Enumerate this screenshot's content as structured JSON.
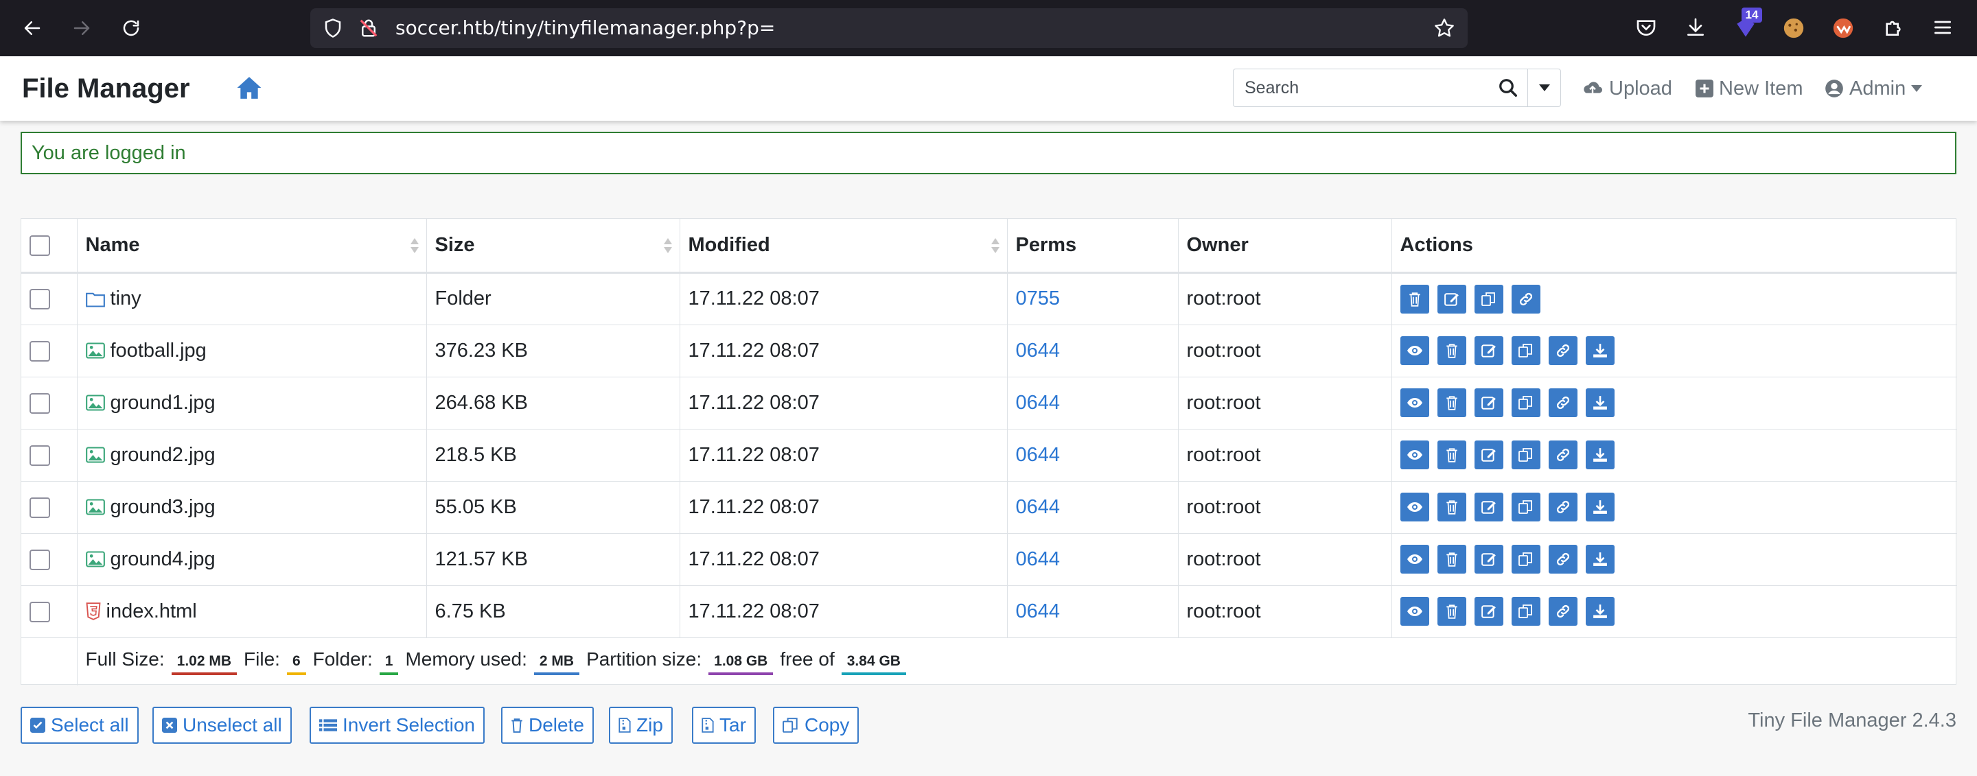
{
  "browser": {
    "url": "soccer.htb/tiny/tinyfilemanager.php?p=",
    "extension_badge": "14"
  },
  "header": {
    "title": "File Manager",
    "search_placeholder": "Search",
    "upload_label": "Upload",
    "new_item_label": "New Item",
    "user_label": "Admin"
  },
  "alert": {
    "message": "You are logged in"
  },
  "table": {
    "columns": {
      "name": "Name",
      "size": "Size",
      "modified": "Modified",
      "perms": "Perms",
      "owner": "Owner",
      "actions": "Actions"
    },
    "rows": [
      {
        "name": "tiny",
        "type": "folder",
        "size": "Folder",
        "modified": "17.11.22 08:07",
        "perms": "0755",
        "owner": "root:root"
      },
      {
        "name": "football.jpg",
        "type": "image",
        "size": "376.23 KB",
        "modified": "17.11.22 08:07",
        "perms": "0644",
        "owner": "root:root"
      },
      {
        "name": "ground1.jpg",
        "type": "image",
        "size": "264.68 KB",
        "modified": "17.11.22 08:07",
        "perms": "0644",
        "owner": "root:root"
      },
      {
        "name": "ground2.jpg",
        "type": "image",
        "size": "218.5 KB",
        "modified": "17.11.22 08:07",
        "perms": "0644",
        "owner": "root:root"
      },
      {
        "name": "ground3.jpg",
        "type": "image",
        "size": "55.05 KB",
        "modified": "17.11.22 08:07",
        "perms": "0644",
        "owner": "root:root"
      },
      {
        "name": "ground4.jpg",
        "type": "image",
        "size": "121.57 KB",
        "modified": "17.11.22 08:07",
        "perms": "0644",
        "owner": "root:root"
      },
      {
        "name": "index.html",
        "type": "html",
        "size": "6.75 KB",
        "modified": "17.11.22 08:07",
        "perms": "0644",
        "owner": "root:root"
      }
    ],
    "summary": {
      "full_size_label": "Full Size:",
      "full_size": "1.02 MB",
      "file_label": "File:",
      "file_count": "6",
      "folder_label": "Folder:",
      "folder_count": "1",
      "memory_label": "Memory used:",
      "memory": "2 MB",
      "partition_label": "Partition size:",
      "partition": "1.08 GB",
      "free_label": "free of",
      "free": "3.84 GB"
    }
  },
  "footer": {
    "select_all": "Select all",
    "unselect_all": "Unselect all",
    "invert_selection": "Invert Selection",
    "delete": "Delete",
    "zip": "Zip",
    "tar": "Tar",
    "copy": "Copy",
    "version": "Tiny File Manager 2.4.3"
  },
  "colors": {
    "accent": "#3a7bc8",
    "alert_green": "#2e7d32",
    "pill_fullsize": "#c0392b",
    "pill_file": "#f0b400",
    "pill_folder": "#28a745",
    "pill_memory": "#3a7bc8",
    "pill_partition": "#8e44ad",
    "pill_free": "#17a2b8"
  }
}
